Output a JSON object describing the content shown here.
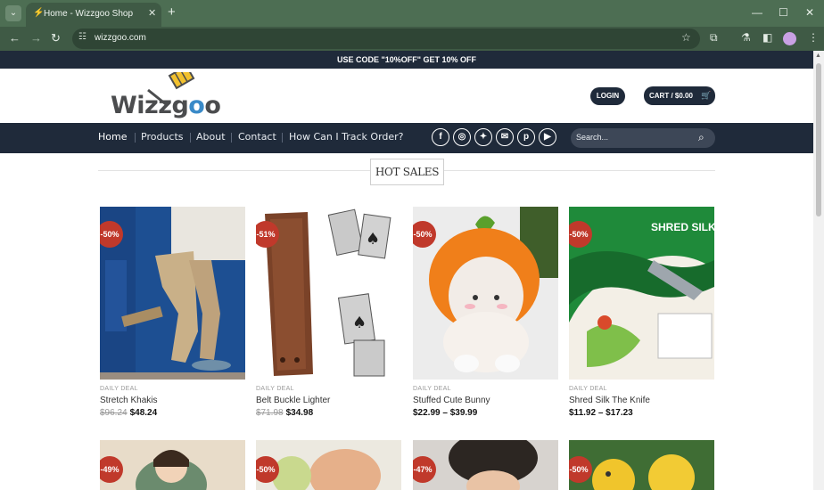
{
  "browser": {
    "tab_title": "Home - Wizzgoo Shop",
    "url": "wizzgoo.com"
  },
  "promo": {
    "text": "USE CODE \"10%OFF\" GET 10% OFF"
  },
  "header": {
    "logo_text": "Wizzgoo",
    "login_label": "LOGIN",
    "cart_label": "CART / $0.00"
  },
  "nav": {
    "items": [
      "Home",
      "Products",
      "About",
      "Contact",
      "How Can I Track Order?"
    ],
    "search_placeholder": "Search...",
    "social": [
      "facebook",
      "instagram",
      "twitter",
      "email",
      "pinterest",
      "youtube"
    ]
  },
  "section": {
    "title": "HOT SALES"
  },
  "products": [
    {
      "badge": "-50%",
      "category": "DAILY DEAL",
      "name": "Stretch Khakis",
      "old_price": "$96.24",
      "price": "$48.24"
    },
    {
      "badge": "-51%",
      "category": "DAILY DEAL",
      "name": "Belt Buckle Lighter",
      "old_price": "$71.98",
      "price": "$34.98"
    },
    {
      "badge": "-50%",
      "category": "DAILY DEAL",
      "name": "Stuffed Cute Bunny",
      "old_price": "",
      "price": "$22.99 – $39.99"
    },
    {
      "badge": "-50%",
      "category": "DAILY DEAL",
      "name": "Shred Silk The Knife",
      "old_price": "",
      "price": "$11.92 – $17.23",
      "image_text": "SHRED SILK THE KNIFE"
    }
  ],
  "row2_badges": [
    "-49%",
    "-50%",
    "-47%",
    "-50%"
  ],
  "colors": {
    "navy": "#1f2a3a",
    "badge": "#c0392b",
    "chrome": "#4d6e53"
  }
}
